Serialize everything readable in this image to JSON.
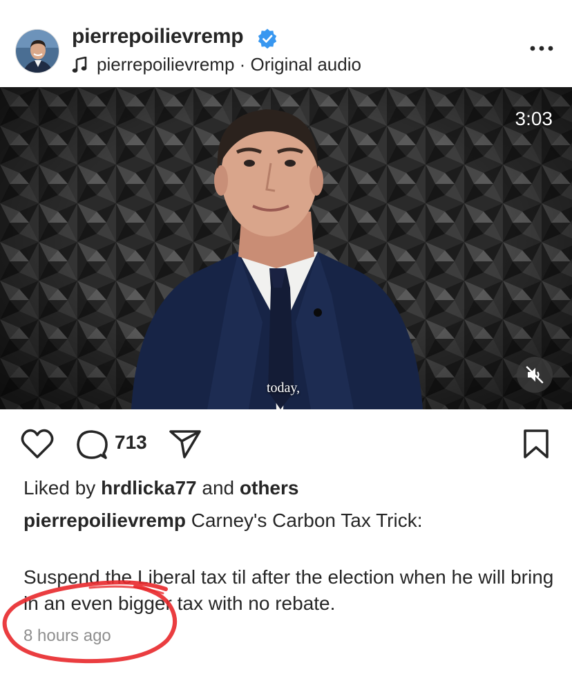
{
  "post": {
    "username": "pierrepoilievremp",
    "audio_label": "pierrepoilievremp · Original audio",
    "video": {
      "duration": "3:03",
      "caption": "today,"
    },
    "comment_count": "713",
    "liked_prefix": "Liked by",
    "liked_user": "hrdlicka77",
    "liked_and": "and",
    "liked_others": "others",
    "caption_author": "pierrepoilievremp",
    "caption_title": "Carney's Carbon Tax Trick:",
    "caption_body": "Suspend the Liberal tax til after the election when he will bring in an even bigger tax with no rebate.",
    "timestamp": "8 hours ago"
  },
  "icons": {
    "verified": "verified-badge-icon",
    "music": "music-note-icon",
    "more": "more-options-icon",
    "mute": "muted-speaker-icon",
    "like": "heart-icon",
    "comment": "comment-icon",
    "share": "share-icon",
    "save": "bookmark-icon"
  },
  "colors": {
    "verified_blue": "#3897f0",
    "text": "#262626",
    "secondary_text": "#8e8e8e",
    "annotation_red": "#e8282b"
  }
}
